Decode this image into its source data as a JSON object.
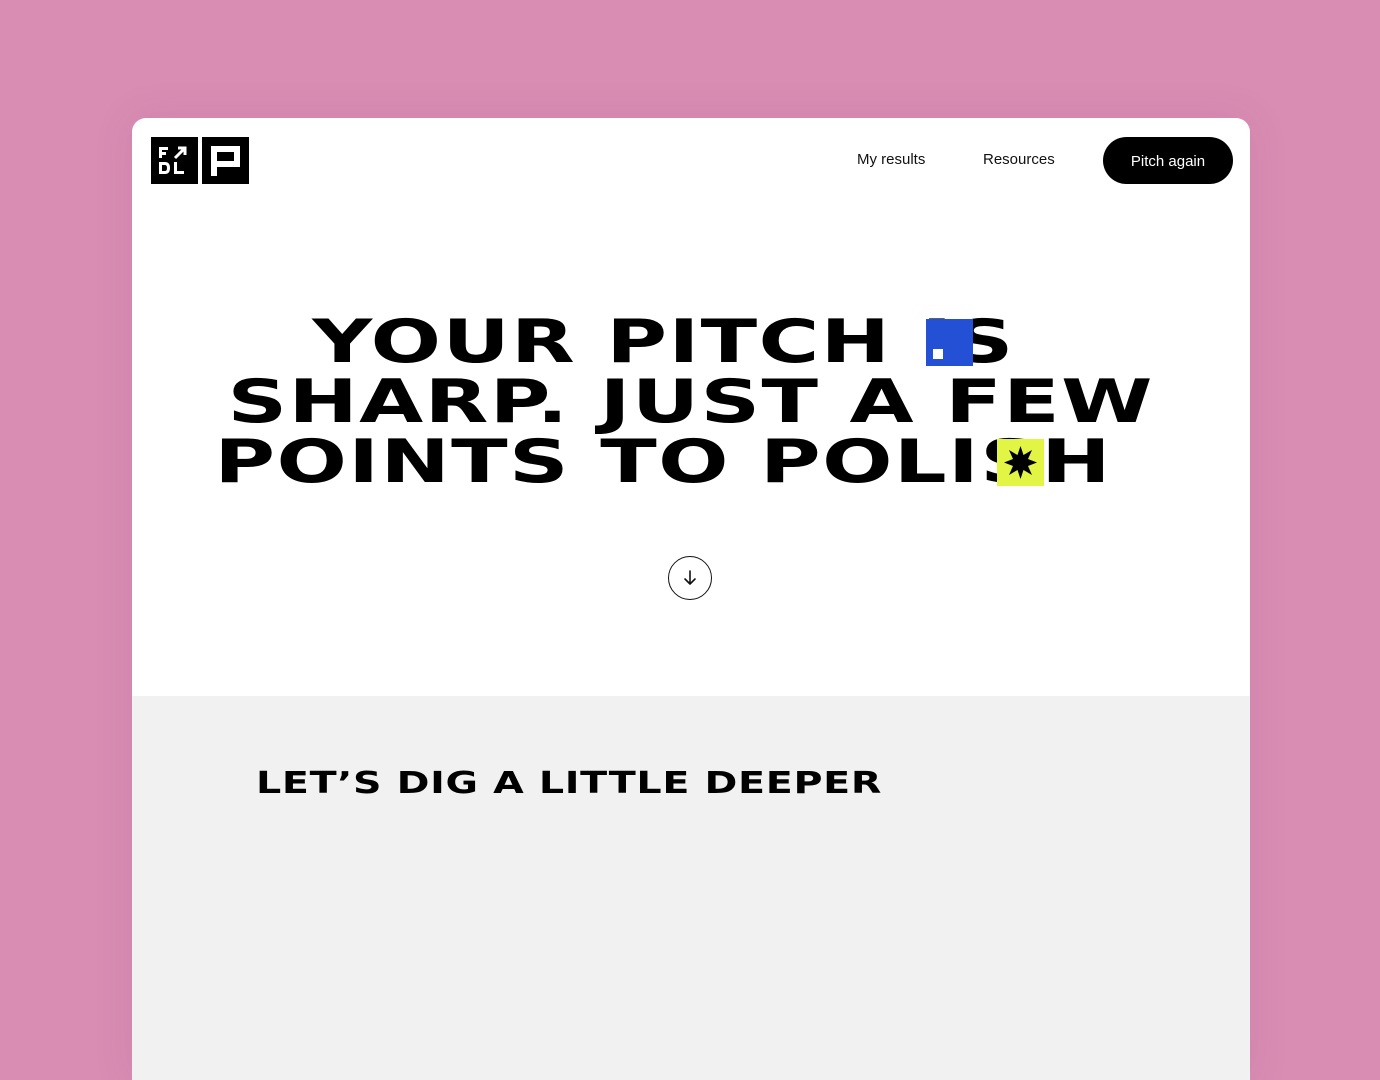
{
  "brand": {
    "logo_text": "FDL",
    "accent_blue": "#2450d6",
    "accent_lime": "#e2f544",
    "background": "#d98db3"
  },
  "nav": {
    "my_results": "My results",
    "resources": "Resources",
    "pitch_again": "Pitch again"
  },
  "hero": {
    "line1": "YOUR PITCH IS",
    "line2": "SHARP. JUST A FEW",
    "line3": "POINTS TO POLISH",
    "scroll_icon": "arrow-down-icon"
  },
  "section": {
    "title": "LET’S DIG A LITTLE DEEPER"
  }
}
